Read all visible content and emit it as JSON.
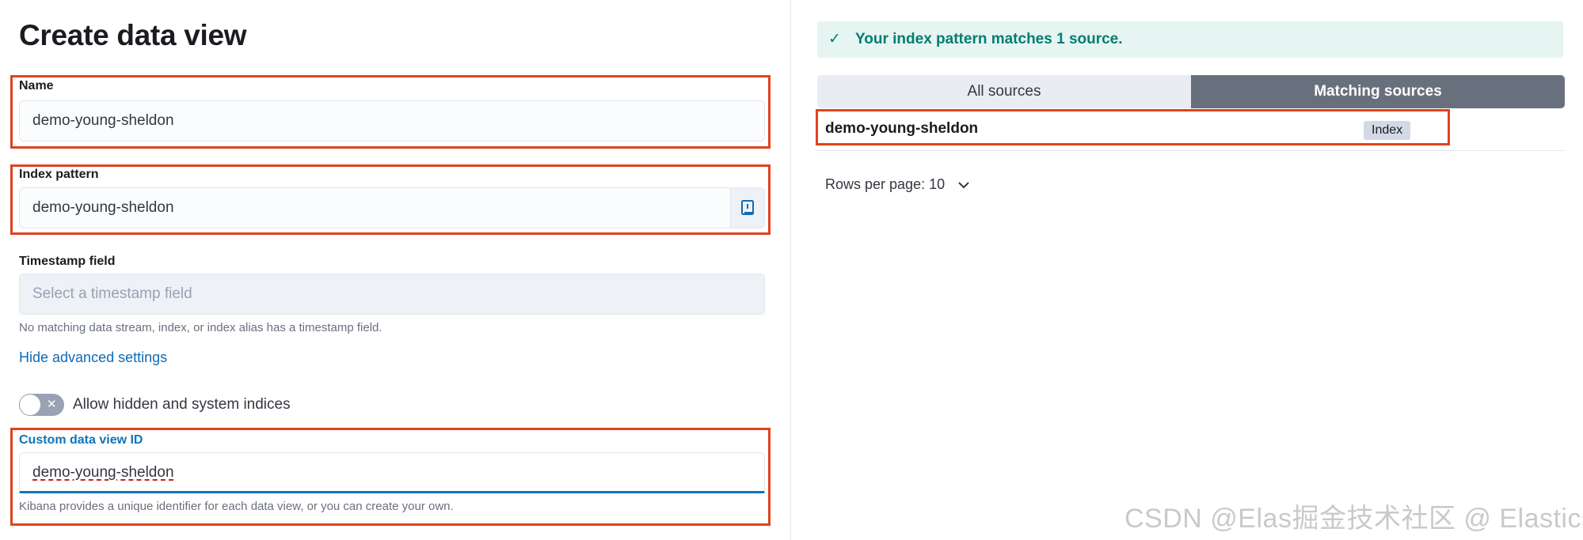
{
  "page_title": "Create data view",
  "name_field": {
    "label": "Name",
    "value": "demo-young-sheldon"
  },
  "index_pattern_field": {
    "label": "Index pattern",
    "value": "demo-young-sheldon"
  },
  "timestamp_field": {
    "label": "Timestamp field",
    "placeholder": "Select a timestamp field",
    "help": "No matching data stream, index, or index alias has a timestamp field."
  },
  "advanced_link": "Hide advanced settings",
  "hidden_toggle": {
    "label": "Allow hidden and system indices",
    "checked": false
  },
  "custom_id_field": {
    "label": "Custom data view ID",
    "value": "demo-young-sheldon",
    "help": "Kibana provides a unique identifier for each data view, or you can create your own."
  },
  "callout": {
    "text": "Your index pattern matches 1 source."
  },
  "tabs": [
    {
      "label": "All sources"
    },
    {
      "label": "Matching sources"
    }
  ],
  "sources": [
    {
      "name": "demo-young-sheldon",
      "type": "Index"
    }
  ],
  "pagination": {
    "rows_per_page": "Rows per page: 10"
  },
  "watermark": "CSDN @Elas掘金技术社区 @ Elasticsearch",
  "colors": {
    "accent": "#0f74b8",
    "highlight": "#e0431e",
    "success": "#017d73"
  }
}
